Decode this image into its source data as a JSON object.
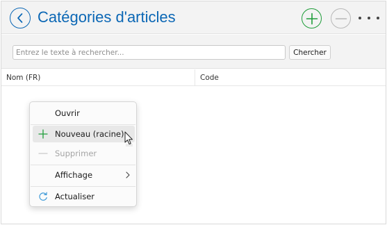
{
  "header": {
    "title": "Catégories d'articles"
  },
  "search": {
    "placeholder": "Entrez le texte à rechercher...",
    "value": "",
    "button_label": "Chercher"
  },
  "table": {
    "columns": [
      "Nom (FR)",
      "Code"
    ],
    "rows": []
  },
  "context_menu": {
    "items": [
      {
        "label": "Ouvrir",
        "icon": "",
        "enabled": true
      },
      {
        "label": "Nouveau (racine)",
        "icon": "plus-icon",
        "enabled": true,
        "hovered": true
      },
      {
        "label": "Supprimer",
        "icon": "minus-icon",
        "enabled": false
      },
      {
        "label": "Affichage",
        "icon": "",
        "enabled": true,
        "submenu": true
      },
      {
        "label": "Actualiser",
        "icon": "refresh-icon",
        "enabled": true
      }
    ]
  },
  "colors": {
    "accent": "#0b67b5",
    "add": "#1f9d3a",
    "disabled": "#b8b8b8",
    "refresh": "#3d9ad8"
  }
}
